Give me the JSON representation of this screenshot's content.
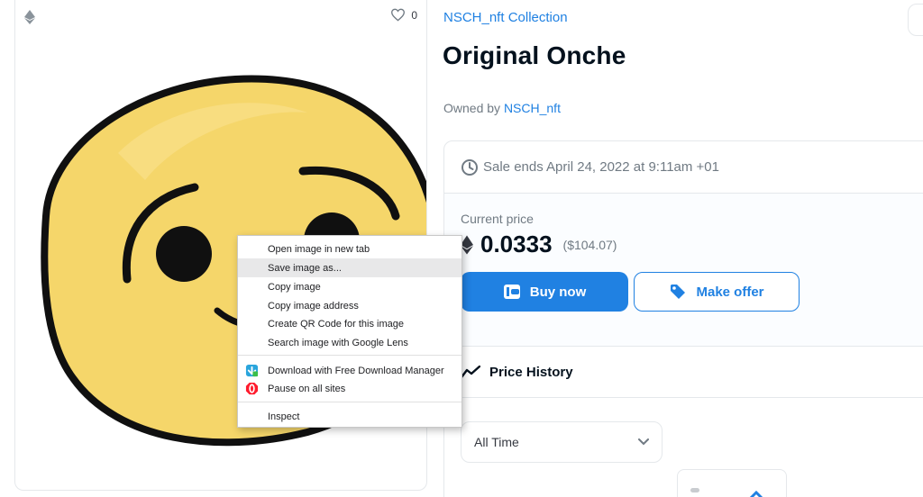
{
  "card": {
    "favorite_count": "0",
    "image_alt": "Onche smiley artwork"
  },
  "asset": {
    "collection": "NSCH_nft Collection",
    "title": "Original Onche",
    "owned_prefix": "Owned by",
    "owner": "NSCH_nft"
  },
  "sale": {
    "ends_text": "Sale ends April 24, 2022 at 9:11am +01",
    "current_price_label": "Current price",
    "price": "0.0333",
    "price_usd": "($104.07)",
    "buy_label": "Buy now",
    "offer_label": "Make offer"
  },
  "history": {
    "title": "Price History",
    "range_value": "All Time"
  },
  "context_menu": {
    "items": [
      {
        "label": "Open image in new tab"
      },
      {
        "label": "Save image as..."
      },
      {
        "label": "Copy image"
      },
      {
        "label": "Copy image address"
      },
      {
        "label": "Create QR Code for this image"
      },
      {
        "label": "Search image with Google Lens"
      },
      {
        "label": "Download with Free Download Manager",
        "icon": "fdm-icon"
      },
      {
        "label": "Pause on all sites",
        "icon": "opera-block-icon"
      },
      {
        "label": "Inspect"
      }
    ],
    "highlighted_index": 1
  },
  "colors": {
    "accent": "#2081e2",
    "text_primary": "#04111d",
    "text_secondary": "#707a83",
    "smiley_fill": "#f5d66a",
    "opera_red": "#ff1b2d"
  }
}
